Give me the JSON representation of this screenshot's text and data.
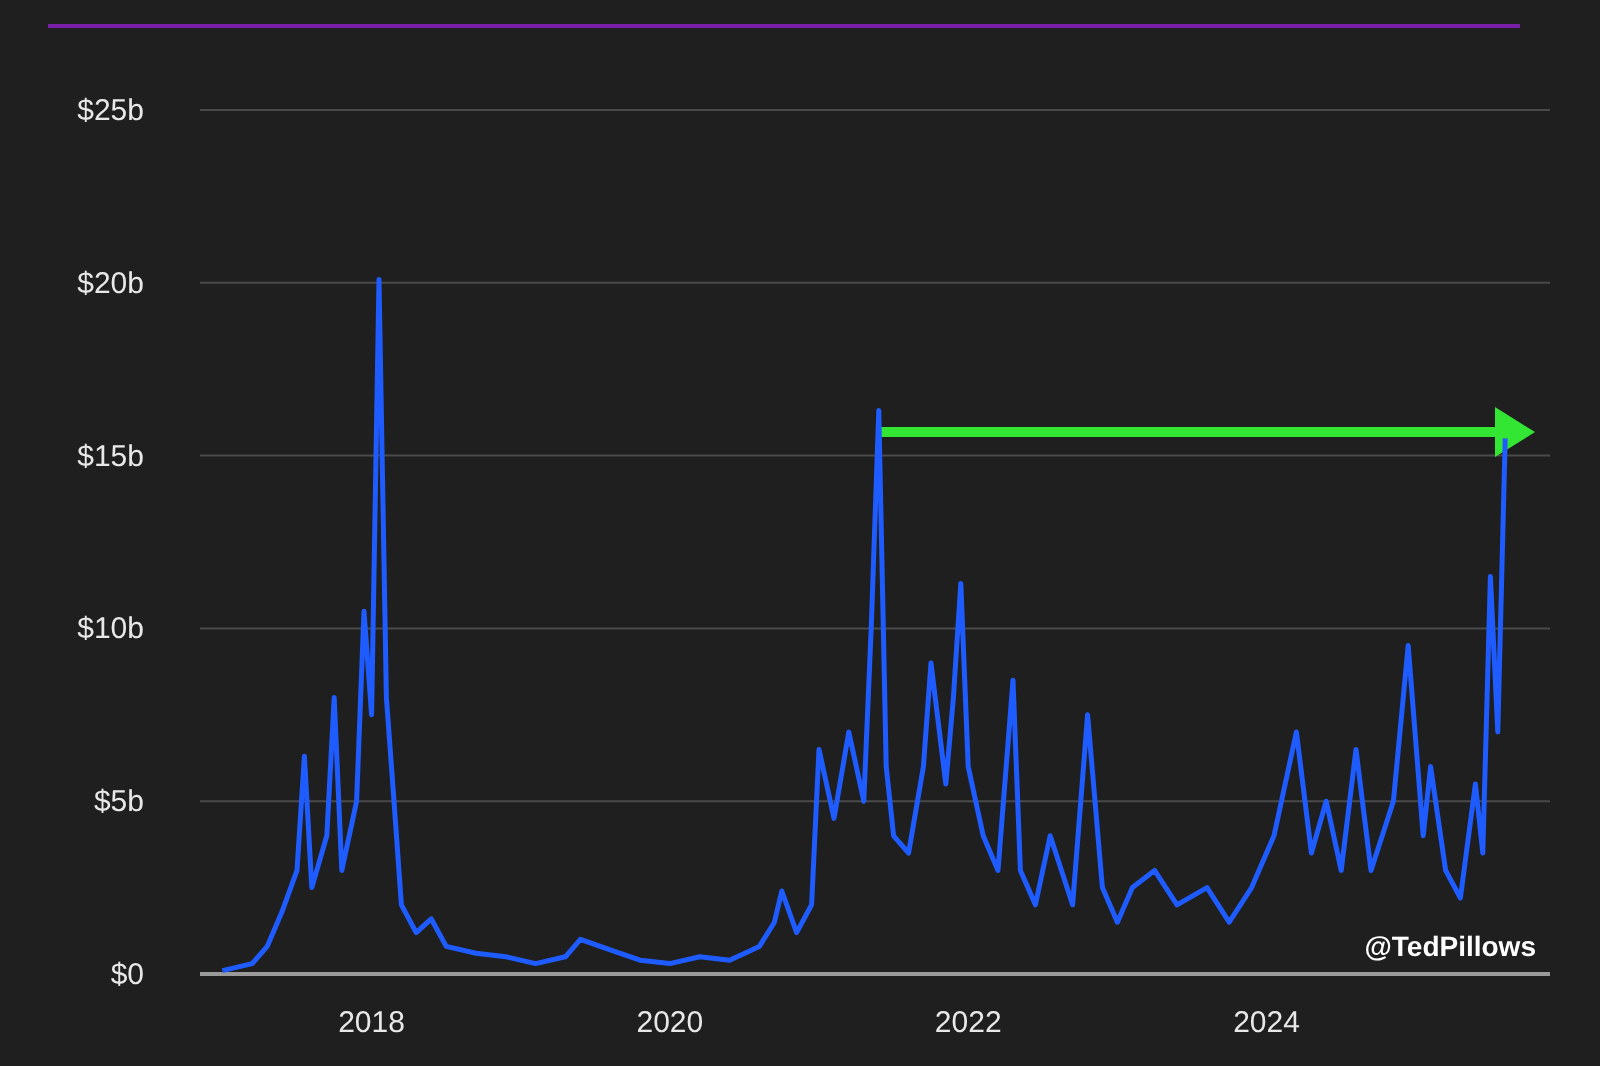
{
  "chart_data": {
    "type": "line",
    "x": [
      2017.0,
      2017.2,
      2017.3,
      2017.4,
      2017.5,
      2017.55,
      2017.6,
      2017.7,
      2017.75,
      2017.8,
      2017.9,
      2017.95,
      2018.0,
      2018.05,
      2018.1,
      2018.15,
      2018.2,
      2018.3,
      2018.4,
      2018.5,
      2018.7,
      2018.9,
      2019.1,
      2019.3,
      2019.4,
      2019.6,
      2019.8,
      2020.0,
      2020.2,
      2020.4,
      2020.6,
      2020.7,
      2020.75,
      2020.85,
      2020.95,
      2021.0,
      2021.1,
      2021.2,
      2021.3,
      2021.35,
      2021.4,
      2021.45,
      2021.5,
      2021.6,
      2021.7,
      2021.75,
      2021.85,
      2021.9,
      2021.95,
      2022.0,
      2022.1,
      2022.2,
      2022.3,
      2022.35,
      2022.45,
      2022.55,
      2022.7,
      2022.8,
      2022.9,
      2023.0,
      2023.1,
      2023.25,
      2023.4,
      2023.6,
      2023.75,
      2023.9,
      2024.05,
      2024.2,
      2024.3,
      2024.4,
      2024.5,
      2024.6,
      2024.7,
      2024.85,
      2024.95,
      2025.05,
      2025.1,
      2025.2,
      2025.3,
      2025.4,
      2025.45,
      2025.5,
      2025.55,
      2025.6
    ],
    "series": [
      {
        "color": "#1f5cff",
        "values": [
          0.1,
          0.3,
          0.8,
          1.8,
          3,
          6.3,
          2.5,
          4,
          8,
          3,
          5,
          10.5,
          7.5,
          20.1,
          8,
          5,
          2,
          1.2,
          1.6,
          0.8,
          0.6,
          0.5,
          0.3,
          0.5,
          1.0,
          0.7,
          0.4,
          0.3,
          0.5,
          0.4,
          0.8,
          1.5,
          2.4,
          1.2,
          2,
          6.5,
          4.5,
          7,
          5,
          10,
          16.3,
          6,
          4,
          3.5,
          6,
          9,
          5.5,
          8,
          11.3,
          6,
          4,
          3,
          8.5,
          3,
          2,
          4,
          2,
          7.5,
          2.5,
          1.5,
          2.5,
          3,
          2,
          2.5,
          1.5,
          2.5,
          4,
          7,
          3.5,
          5,
          3,
          6.5,
          3,
          5,
          9.5,
          4,
          6,
          3,
          2.2,
          5.5,
          3.5,
          11.5,
          7,
          15.5
        ]
      }
    ],
    "xlim": [
      2016.85,
      2025.9
    ],
    "ylim": [
      0,
      25
    ],
    "xticks": [
      2018,
      2020,
      2022,
      2024
    ],
    "yticks": [
      {
        "value": 0,
        "label": "$0"
      },
      {
        "value": 5,
        "label": "$5b"
      },
      {
        "value": 10,
        "label": "$10b"
      },
      {
        "value": 15,
        "label": "$15b"
      },
      {
        "value": 20,
        "label": "$20b"
      },
      {
        "value": 25,
        "label": "$25b"
      }
    ],
    "grid": true,
    "annotations": [
      "@TedPillows"
    ]
  }
}
